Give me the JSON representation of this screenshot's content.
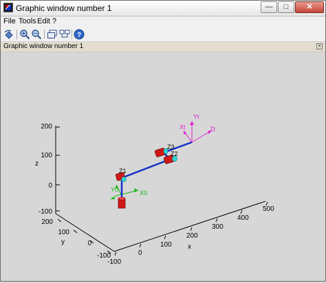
{
  "window": {
    "title": "Graphic window number 1",
    "minimize_label": "—",
    "maximize_label": "□",
    "close_label": "✕"
  },
  "menu": {
    "items": [
      "File",
      "Tools",
      "Edit",
      "?"
    ]
  },
  "toolbar": {
    "icons": [
      "rotate-icon",
      "zoom-in-icon",
      "zoom-out-icon",
      "window-icon",
      "datatip-icon",
      "help-icon"
    ]
  },
  "header": {
    "label": "Graphic window number 1"
  },
  "plot": {
    "axes": {
      "x": {
        "label": "x",
        "ticks": [
          "-100",
          "0",
          "100",
          "200",
          "300",
          "400",
          "500"
        ]
      },
      "y": {
        "label": "y",
        "ticks": [
          "200",
          "100",
          "0",
          "-100"
        ]
      },
      "z": {
        "label": "z",
        "ticks": [
          "200",
          "100",
          "0",
          "-100"
        ]
      }
    },
    "frames": {
      "base": [
        "Y0",
        "X0"
      ],
      "joints": [
        "Z1",
        "Z3",
        "Z2"
      ],
      "tool": [
        "Yt",
        "Xt",
        "Zt"
      ]
    },
    "colors": {
      "link": "#1530c8",
      "joint": "#d01818",
      "joint_dark": "#7a0a0a",
      "joint_cap": "#2ad7d7",
      "base_frame": "#16b616",
      "tool_frame": "#e020d0",
      "axis": "#000000"
    }
  }
}
